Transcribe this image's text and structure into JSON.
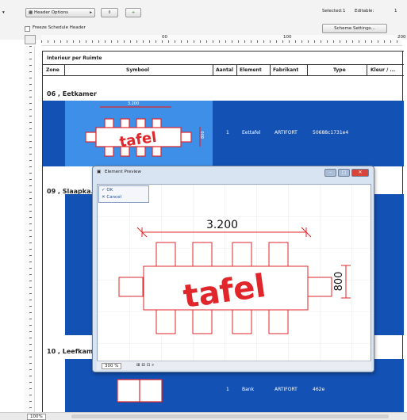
{
  "toolbar": {
    "header_options": "Header Options",
    "freeze_label": "Freeze Schedule Header",
    "selected_label": "Selected:",
    "selected_value": "1",
    "editable_label": "Editable:",
    "editable_value": "1",
    "scheme_button": "Scheme Settings..."
  },
  "ruler": {
    "marks": [
      "00",
      "100",
      "200"
    ]
  },
  "schedule": {
    "title": "Interieur per Ruimte",
    "columns": [
      "Zone",
      "Symbool",
      "Aantal",
      "Element",
      "Fabrikant",
      "Type",
      "Kleur / ..."
    ],
    "sections": [
      {
        "heading": "06 , Eetkamer"
      },
      {
        "heading": "09 , Slaapka..."
      },
      {
        "heading": "10 , Leefkam..."
      }
    ],
    "rows": [
      {
        "aantal": "1",
        "element": "Eettafel",
        "fabrikant": "ARTIFORT",
        "type": "50688c1731e4"
      },
      {
        "aantal": "1",
        "element": "Bank",
        "fabrikant": "ARTIFORT",
        "type": "462e"
      }
    ],
    "thumb_dim_width": "3.200",
    "thumb_dim_height": "800",
    "thumb_label": "tafel"
  },
  "preview": {
    "title": "Element Preview",
    "menu_ok": "OK",
    "menu_cancel": "Cancel",
    "dim_width": "3.200",
    "dim_height": "800",
    "label": "tafel",
    "zoom": "300 %"
  },
  "statusbar": {
    "zoom": "100%"
  },
  "colors": {
    "accent_blue": "#1351b4",
    "selection_blue": "#3d8fe8",
    "symbol_red": "#e0262a"
  }
}
